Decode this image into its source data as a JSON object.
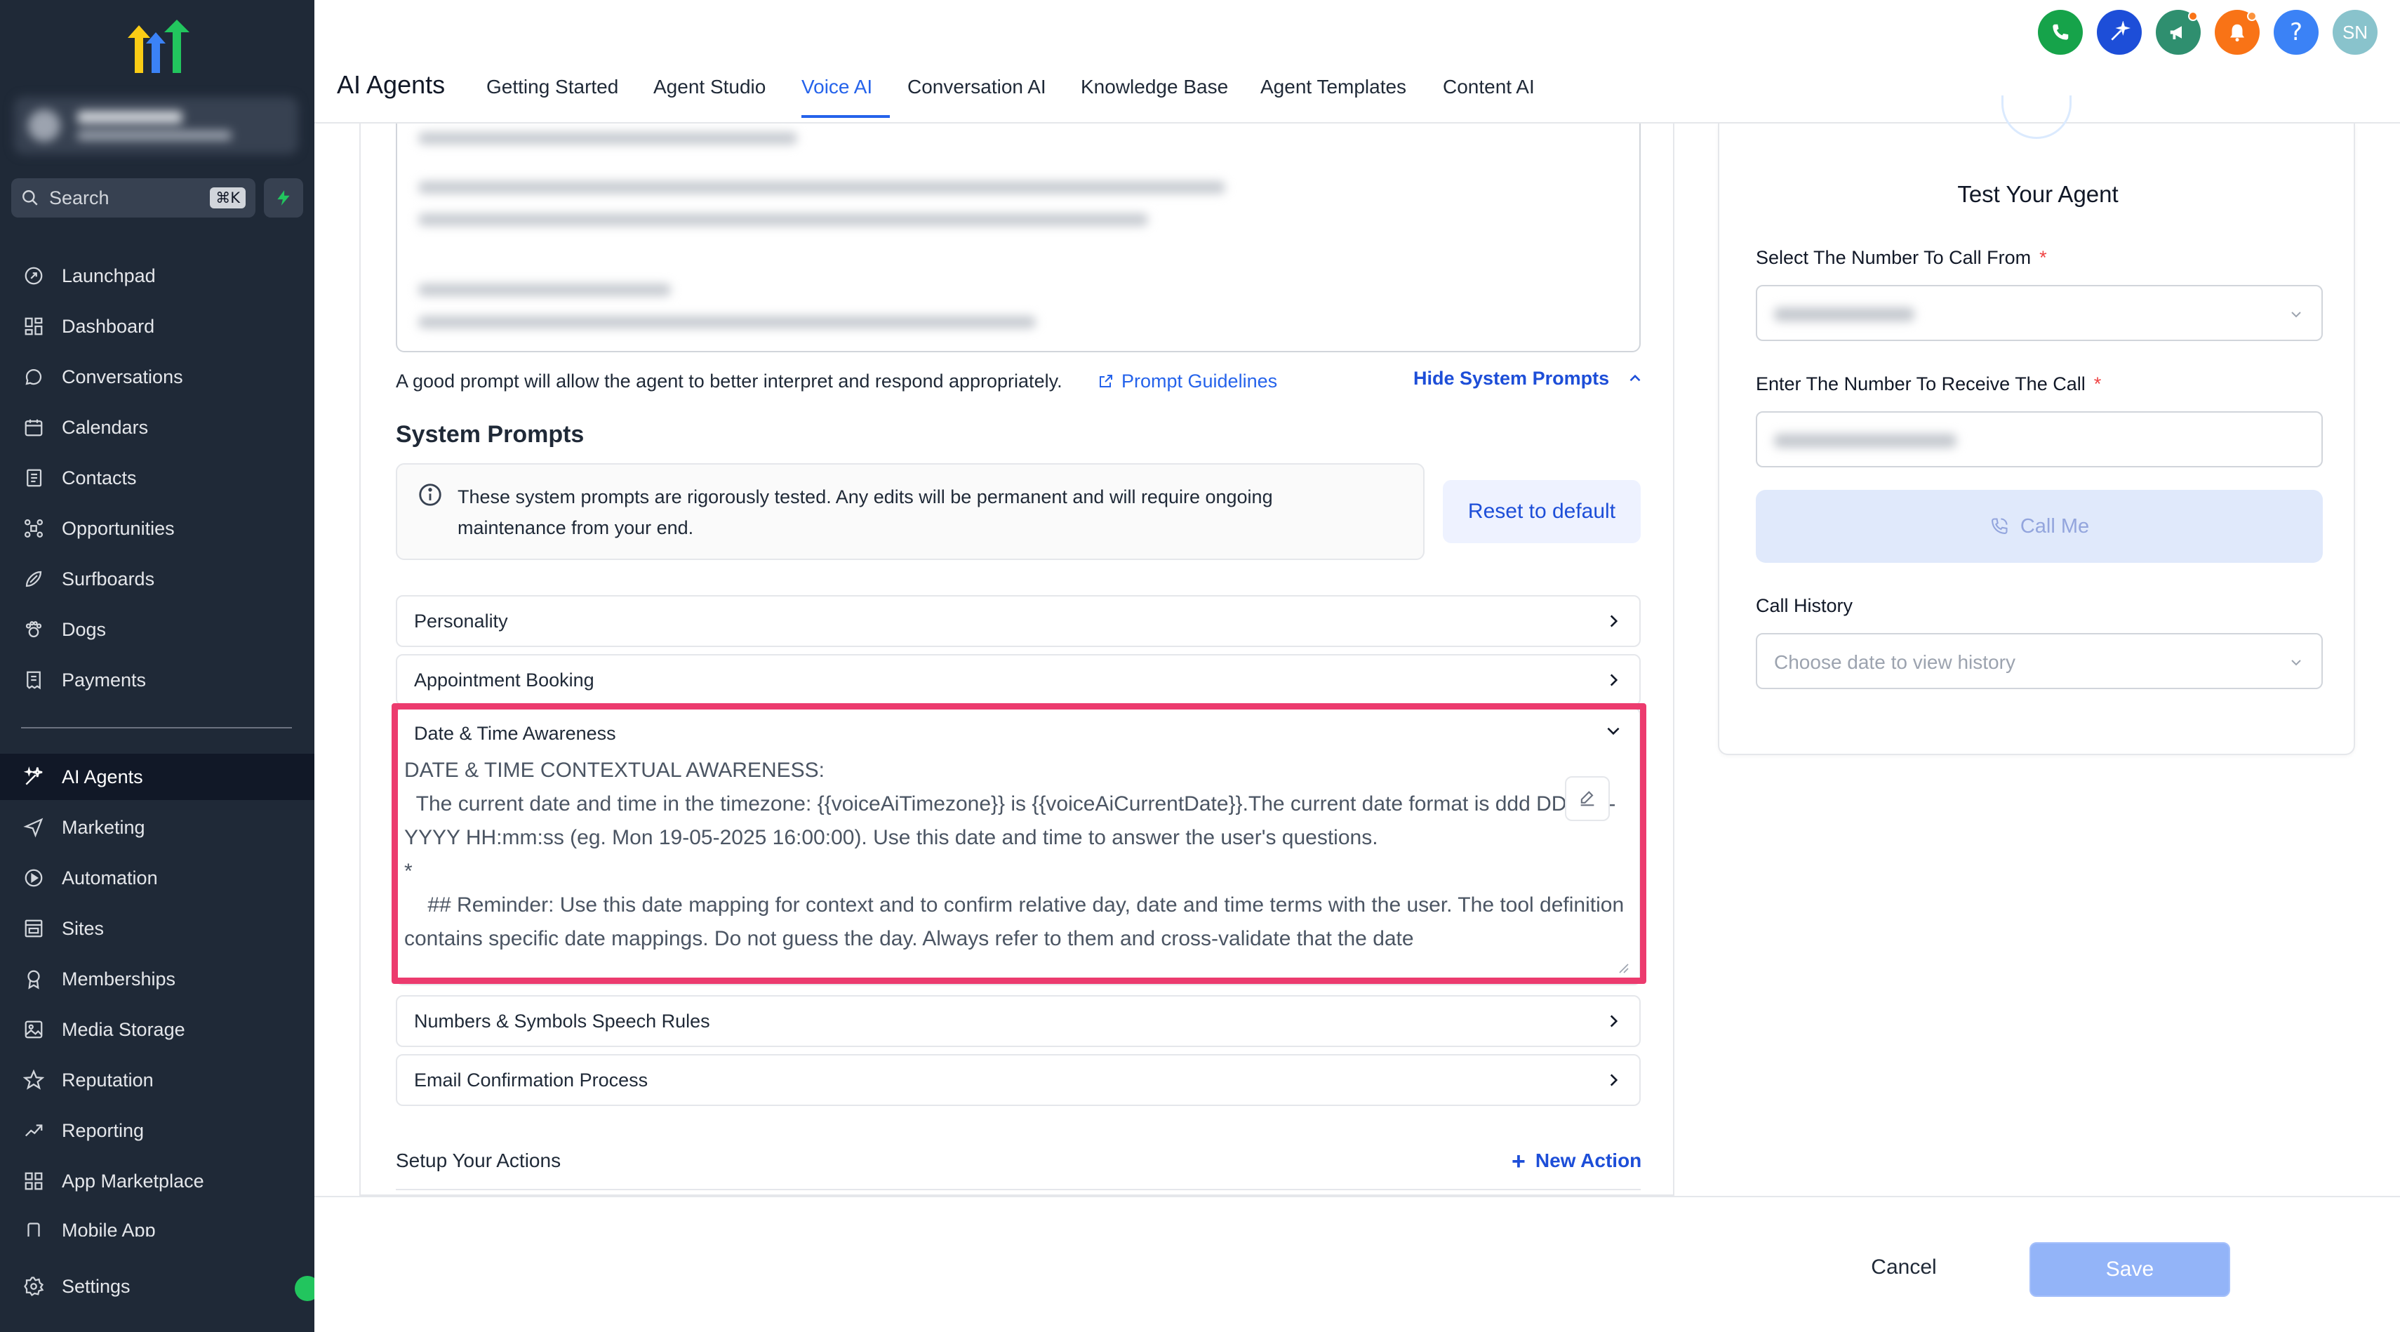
{
  "sidebar": {
    "search": {
      "label": "Search",
      "shortcut": "⌘K"
    },
    "items": [
      {
        "label": "Launchpad",
        "icon": "rocket-icon"
      },
      {
        "label": "Dashboard",
        "icon": "grid-icon"
      },
      {
        "label": "Conversations",
        "icon": "chat-icon"
      },
      {
        "label": "Calendars",
        "icon": "calendar-icon"
      },
      {
        "label": "Contacts",
        "icon": "contacts-icon"
      },
      {
        "label": "Opportunities",
        "icon": "opportunities-icon"
      },
      {
        "label": "Surfboards",
        "icon": "surfboard-icon"
      },
      {
        "label": "Dogs",
        "icon": "paw-icon"
      },
      {
        "label": "Payments",
        "icon": "receipt-icon"
      },
      {
        "label": "AI Agents",
        "icon": "sparkles-icon",
        "active": true
      },
      {
        "label": "Marketing",
        "icon": "send-icon"
      },
      {
        "label": "Automation",
        "icon": "automation-icon"
      },
      {
        "label": "Sites",
        "icon": "sites-icon"
      },
      {
        "label": "Memberships",
        "icon": "badge-icon"
      },
      {
        "label": "Media Storage",
        "icon": "image-icon"
      },
      {
        "label": "Reputation",
        "icon": "star-icon"
      },
      {
        "label": "Reporting",
        "icon": "trend-icon"
      },
      {
        "label": "App Marketplace",
        "icon": "apps-icon"
      },
      {
        "label": "Mobile App",
        "icon": "mobile-icon"
      }
    ],
    "settings_label": "Settings"
  },
  "header": {
    "title": "AI Agents",
    "tabs": [
      {
        "label": "Getting Started"
      },
      {
        "label": "Agent Studio"
      },
      {
        "label": "Voice AI",
        "active": true
      },
      {
        "label": "Conversation AI"
      },
      {
        "label": "Knowledge Base"
      },
      {
        "label": "Agent Templates"
      },
      {
        "label": "Content AI"
      }
    ],
    "buttons": [
      {
        "icon": "phone-icon",
        "color": "#16a34a"
      },
      {
        "icon": "ai-sparkle-icon",
        "color": "#1d4ed8"
      },
      {
        "icon": "megaphone-icon",
        "color": "#2f8f6f"
      },
      {
        "icon": "bell-icon",
        "color": "#f97316"
      },
      {
        "icon": "help-icon",
        "color": "#3b82f6"
      }
    ],
    "avatar_initials": "SN",
    "avatar_color": "#89c3cc"
  },
  "main": {
    "hint": "A good prompt will allow the agent to better interpret and respond appropriately.",
    "prompt_guidelines": "Prompt Guidelines",
    "hide_system_prompts": "Hide System Prompts",
    "system_prompts_title": "System Prompts",
    "info_text": "These system prompts are rigorously tested. Any edits will be permanent and will require ongoing maintenance from your end.",
    "reset_label": "Reset to default",
    "accordions": {
      "personality": "Personality",
      "appointment": "Appointment Booking",
      "numbers": "Numbers & Symbols Speech Rules",
      "email": "Email Confirmation Process"
    },
    "date_time": {
      "title": "Date & Time Awareness",
      "text": "DATE & TIME CONTEXTUAL AWARENESS:\n  The current date and time in the timezone: {{voiceAiTimezone}} is {{voiceAiCurrentDate}}.The current date format is ddd DD-MM-YYYY HH:mm:ss (eg. Mon 19-05-2025 16:00:00). Use this date and time to answer the user's questions.\n*\n    ## Reminder: Use this date mapping for context and to confirm relative day, date and time terms with the user. The tool definition contains specific date mappings. Do not guess the day. Always refer to them and cross-validate that the date"
    },
    "actions_title": "Setup Your Actions",
    "new_action": "New Action",
    "highlight_color": "#ec3b6e"
  },
  "test_panel": {
    "title": "Test Your Agent",
    "from_label": "Select The Number To Call From",
    "to_label": "Enter The Number To Receive The Call",
    "required_mark": "*",
    "call_me": "Call Me",
    "history_label": "Call History",
    "history_placeholder": "Choose date to view history"
  },
  "footer": {
    "cancel": "Cancel",
    "save": "Save"
  }
}
